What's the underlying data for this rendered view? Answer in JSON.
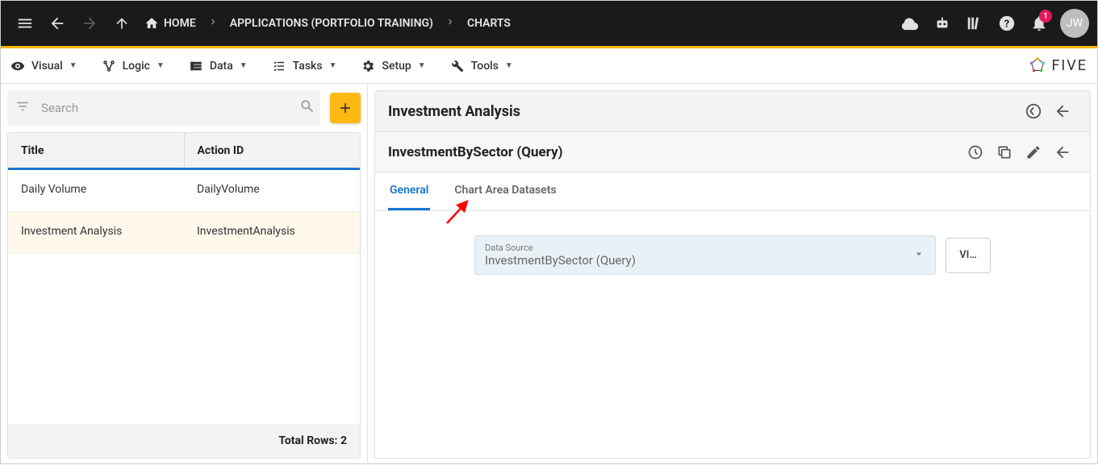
{
  "topbar": {
    "breadcrumb": [
      {
        "label": "HOME",
        "icon": "home"
      },
      {
        "label": "APPLICATIONS (PORTFOLIO TRAINING)"
      },
      {
        "label": "CHARTS"
      }
    ],
    "avatar": "JW",
    "badge_count": "1"
  },
  "menubar": {
    "items": [
      {
        "label": "Visual"
      },
      {
        "label": "Logic"
      },
      {
        "label": "Data"
      },
      {
        "label": "Tasks"
      },
      {
        "label": "Setup"
      },
      {
        "label": "Tools"
      }
    ],
    "brand": "FIVE"
  },
  "left": {
    "search_placeholder": "Search",
    "columns": {
      "c1": "Title",
      "c2": "Action ID"
    },
    "rows": [
      {
        "title": "Daily Volume",
        "action_id": "DailyVolume",
        "selected": false
      },
      {
        "title": "Investment Analysis",
        "action_id": "InvestmentAnalysis",
        "selected": true
      }
    ],
    "footer": "Total Rows: 2"
  },
  "right": {
    "title1": "Investment Analysis",
    "title2": "InvestmentBySector (Query)",
    "tabs": [
      {
        "label": "General",
        "active": true
      },
      {
        "label": "Chart Area Datasets",
        "active": false
      }
    ],
    "form": {
      "label": "Data Source",
      "value": "InvestmentBySector (Query)",
      "view_btn": "VI…"
    }
  }
}
